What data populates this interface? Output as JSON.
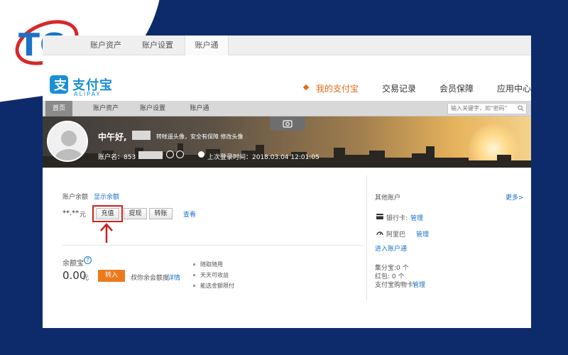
{
  "brand_logo": {
    "text": "TG",
    "accent": "#d62828",
    "primary": "#1a73c8"
  },
  "top_tabs": [
    {
      "label": "账户资产",
      "selected": false
    },
    {
      "label": "账户设置",
      "selected": false
    },
    {
      "label": "账户通",
      "selected": true
    }
  ],
  "header": {
    "brand_name": "支付宝",
    "brand_sub": "ALIPAY",
    "nav": [
      {
        "label": "我的支付宝",
        "active": true
      },
      {
        "label": "交易记录",
        "active": false
      },
      {
        "label": "会员保障",
        "active": false
      },
      {
        "label": "应用中心",
        "active": false
      }
    ]
  },
  "navbar": {
    "items": [
      "首页",
      "账户资产",
      "账户设置",
      "账户通"
    ],
    "search_placeholder": "输入关键字，如\"密码\""
  },
  "banner": {
    "greeting": "中午好,",
    "tip": "转帐遥头像，安全有保障 修改头像",
    "account_label": "账户名：853",
    "last_login": "上次登录时间：2018.03.04 12:01:05"
  },
  "balance": {
    "label": "账户余额",
    "show_link": "显示余额",
    "masked_value": "**.**",
    "unit": "元",
    "buttons": [
      "充值",
      "提现",
      "转账"
    ],
    "view_link": "查看"
  },
  "yuebao": {
    "title": "余额宝",
    "amount": "0.00",
    "unit": "元",
    "transfer_in": "转入",
    "hint": "叔你余会额度",
    "detail_link": "详情",
    "features": [
      "随取随用",
      "天天可收益",
      "能选金额限付"
    ]
  },
  "other_accounts": {
    "title": "其他账户",
    "more": "更多>",
    "bank_card": "银行卡:",
    "bank_manage": "管理",
    "alipay_label": "阿里巴",
    "alipay_manage": "管理",
    "enter_account": "进入账户通",
    "coupons": "集分宝:0 个",
    "red_packets": "红包: 0 个",
    "pay_card": "支付宝购物卡:",
    "pay_card_manage": "管理"
  }
}
